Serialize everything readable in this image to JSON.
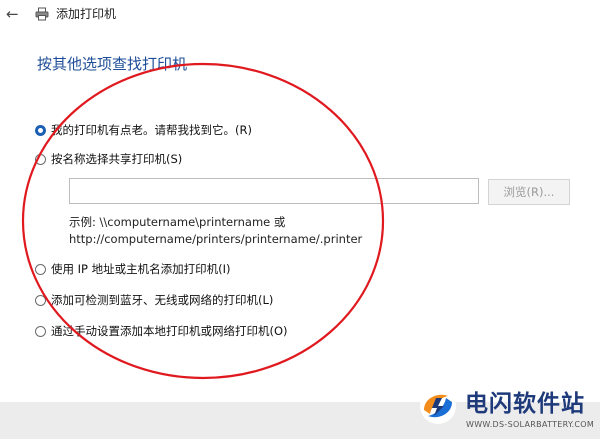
{
  "window": {
    "title": "添加打印机"
  },
  "main": {
    "heading": "按其他选项查找打印机",
    "options": [
      {
        "label": "我的打印机有点老。请帮我找到它。(R)",
        "checked": true
      },
      {
        "label": "按名称选择共享打印机(S)",
        "checked": false
      },
      {
        "label": "使用 IP 地址或主机名添加打印机(I)",
        "checked": false
      },
      {
        "label": "添加可检测到蓝牙、无线或网络的打印机(L)",
        "checked": false
      },
      {
        "label": "通过手动设置添加本地打印机或网络打印机(O)",
        "checked": false
      }
    ],
    "share_input": {
      "value": "",
      "placeholder": ""
    },
    "browse_label": "浏览(R)...",
    "example_line1": "示例: \\\\computername\\printername 或",
    "example_line2": "http://computername/printers/printername/.printer"
  },
  "watermark": {
    "name": "电闪软件站",
    "url": "WWW.DS-SOLARBATTERY.COM"
  },
  "colors": {
    "heading": "#1f4e99",
    "radio_selected": "#1a5fb4",
    "annotation_circle": "#e0191f",
    "watermark_text": "#1e3a7a"
  },
  "icons": {
    "back": "back-arrow-icon",
    "printer": "printer-icon",
    "logo": "watermark-logo-icon"
  }
}
